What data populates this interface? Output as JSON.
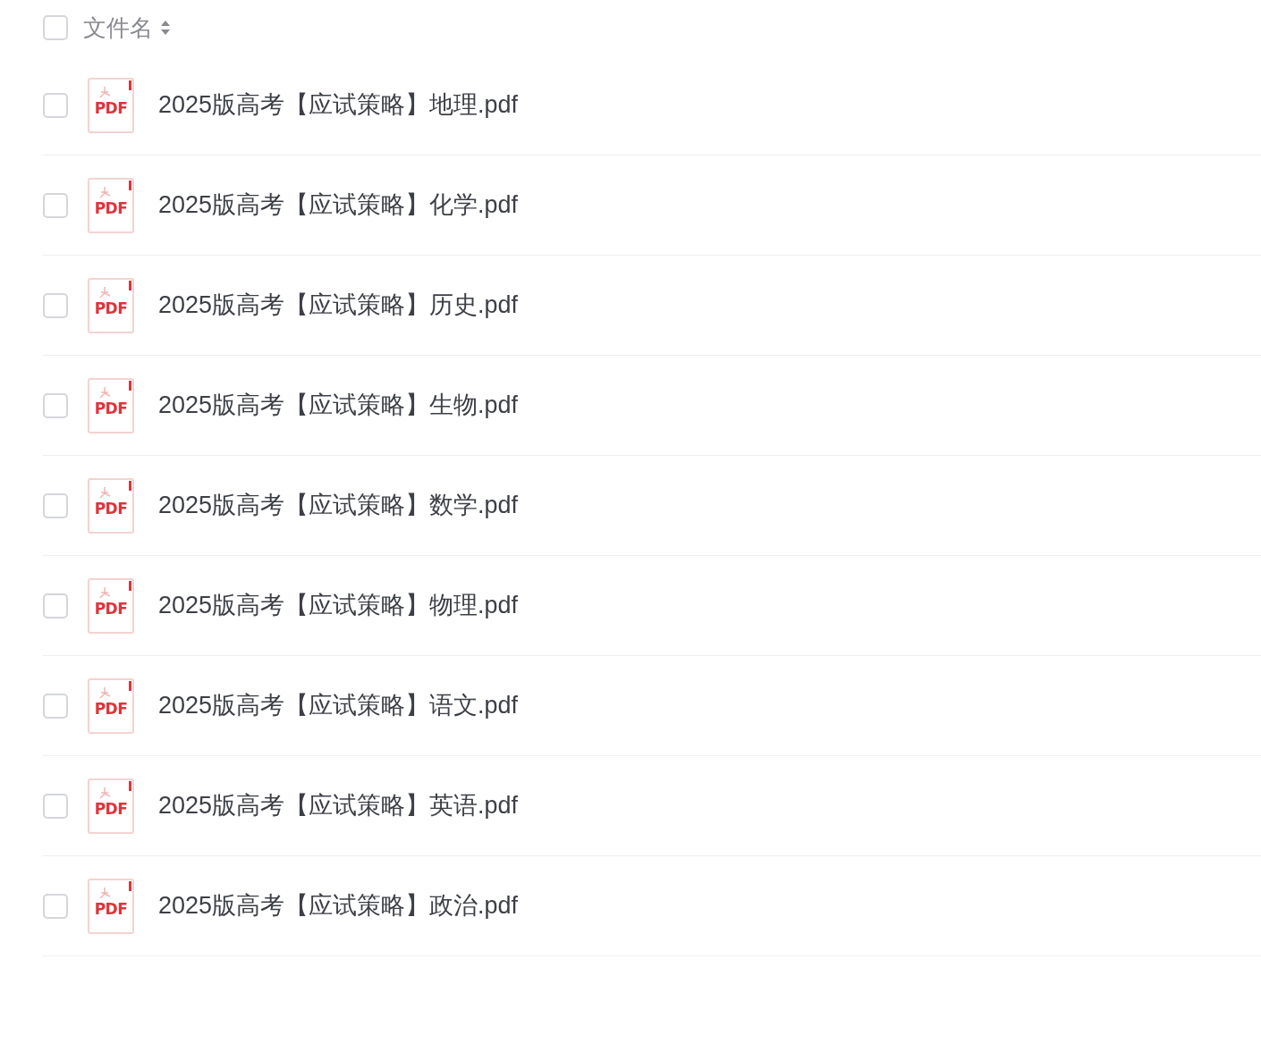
{
  "header": {
    "checked": false,
    "label": "文件名"
  },
  "files": [
    {
      "name": "2025版高考【应试策略】地理.pdf",
      "icon_text": "PDF",
      "checked": false
    },
    {
      "name": "2025版高考【应试策略】化学.pdf",
      "icon_text": "PDF",
      "checked": false
    },
    {
      "name": "2025版高考【应试策略】历史.pdf",
      "icon_text": "PDF",
      "checked": false
    },
    {
      "name": "2025版高考【应试策略】生物.pdf",
      "icon_text": "PDF",
      "checked": false
    },
    {
      "name": "2025版高考【应试策略】数学.pdf",
      "icon_text": "PDF",
      "checked": false
    },
    {
      "name": "2025版高考【应试策略】物理.pdf",
      "icon_text": "PDF",
      "checked": false
    },
    {
      "name": "2025版高考【应试策略】语文.pdf",
      "icon_text": "PDF",
      "checked": false
    },
    {
      "name": "2025版高考【应试策略】英语.pdf",
      "icon_text": "PDF",
      "checked": false
    },
    {
      "name": "2025版高考【应试策略】政治.pdf",
      "icon_text": "PDF",
      "checked": false
    }
  ]
}
